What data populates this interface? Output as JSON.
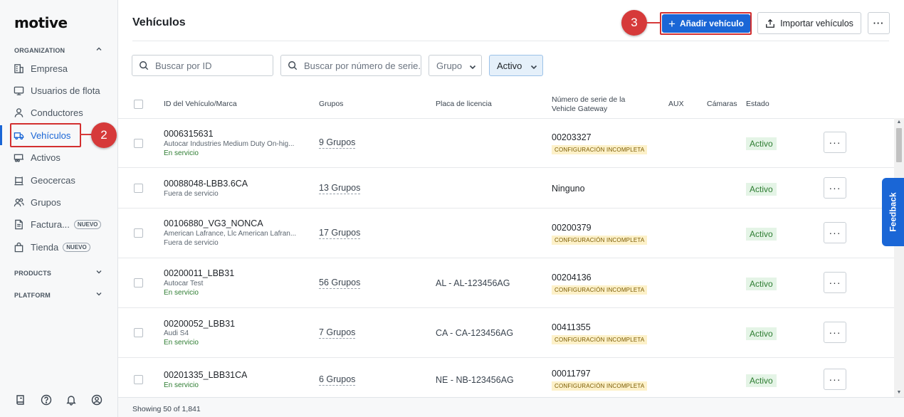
{
  "brand": {
    "logo": "motive"
  },
  "sidebar": {
    "sections": [
      {
        "label": "ORGANIZATION",
        "chevron": "chevron-up-icon"
      },
      {
        "label": "PRODUCTS",
        "chevron": "chevron-down-icon"
      },
      {
        "label": "PLATFORM",
        "chevron": "chevron-down-icon"
      }
    ],
    "items": [
      {
        "label": "Empresa",
        "icon": "building-icon"
      },
      {
        "label": "Usuarios de flota",
        "icon": "monitor-icon"
      },
      {
        "label": "Conductores",
        "icon": "person-icon"
      },
      {
        "label": "Vehículos",
        "icon": "truck-icon",
        "active": true
      },
      {
        "label": "Activos",
        "icon": "trailer-icon"
      },
      {
        "label": "Geocercas",
        "icon": "geofence-icon"
      },
      {
        "label": "Grupos",
        "icon": "users-icon"
      },
      {
        "label": "Factura...",
        "icon": "invoice-icon",
        "badge": "NUEVO"
      },
      {
        "label": "Tienda",
        "icon": "store-icon",
        "badge": "NUEVO"
      }
    ],
    "bottom_icons": [
      "book-icon",
      "help-icon",
      "bell-icon",
      "user-circle-icon"
    ]
  },
  "annotations": {
    "step2": "2",
    "step3": "3",
    "color": "#d63a3a"
  },
  "header": {
    "title": "Vehículos",
    "add_button": "Añadir vehículo",
    "import_button": "Importar vehículos",
    "more_button": "···"
  },
  "filters": {
    "search_id_placeholder": "Buscar por ID",
    "search_serial_placeholder": "Buscar por número de serie...",
    "group_select": "Grupo",
    "status_select": "Activo"
  },
  "table": {
    "columns": {
      "id": "ID del Vehículo/Marca",
      "groups": "Grupos",
      "plate": "Placa de licencia",
      "serial": "Número de serie de la Vehicle Gateway",
      "aux": "AUX",
      "cameras": "Cámaras",
      "status": "Estado"
    },
    "rows": [
      {
        "id": "0006315631",
        "make": "Autocar Industries Medium Duty On-hig...",
        "service": "En servicio",
        "groups": "9 Grupos",
        "plate": "",
        "serial": "00203327",
        "warning": "CONFIGURACIÓN INCOMPLETA",
        "status": "Activo"
      },
      {
        "id": "00088048-LBB3.6CA",
        "make": "",
        "service": "Fuera de servicio",
        "groups": "13 Grupos",
        "plate": "",
        "serial": "Ninguno",
        "warning": "",
        "status": "Activo"
      },
      {
        "id": "00106880_VG3_NONCA",
        "make": "American Lafrance, Llc American Lafran...",
        "service": "Fuera de servicio",
        "groups": "17 Grupos",
        "plate": "",
        "serial": "00200379",
        "warning": "CONFIGURACIÓN INCOMPLETA",
        "status": "Activo"
      },
      {
        "id": "00200011_LBB31",
        "make": "Autocar Test",
        "service": "En servicio",
        "groups": "56 Grupos",
        "plate": "AL - AL-123456AG",
        "serial": "00204136",
        "warning": "CONFIGURACIÓN INCOMPLETA",
        "status": "Activo"
      },
      {
        "id": "00200052_LBB31",
        "make": "Audi S4",
        "service": "En servicio",
        "groups": "7 Grupos",
        "plate": "CA - CA-123456AG",
        "serial": "00411355",
        "warning": "CONFIGURACIÓN INCOMPLETA",
        "status": "Activo"
      },
      {
        "id": "00201335_LBB31CA",
        "make": "",
        "service": "En servicio",
        "groups": "6 Grupos",
        "plate": "NE - NB-123456AG",
        "serial": "00011797",
        "warning": "CONFIGURACIÓN INCOMPLETA",
        "status": "Activo"
      }
    ],
    "row_more": "···"
  },
  "footer": {
    "showing": "Showing 50 of 1,841"
  },
  "feedback": {
    "label": "Feedback"
  }
}
